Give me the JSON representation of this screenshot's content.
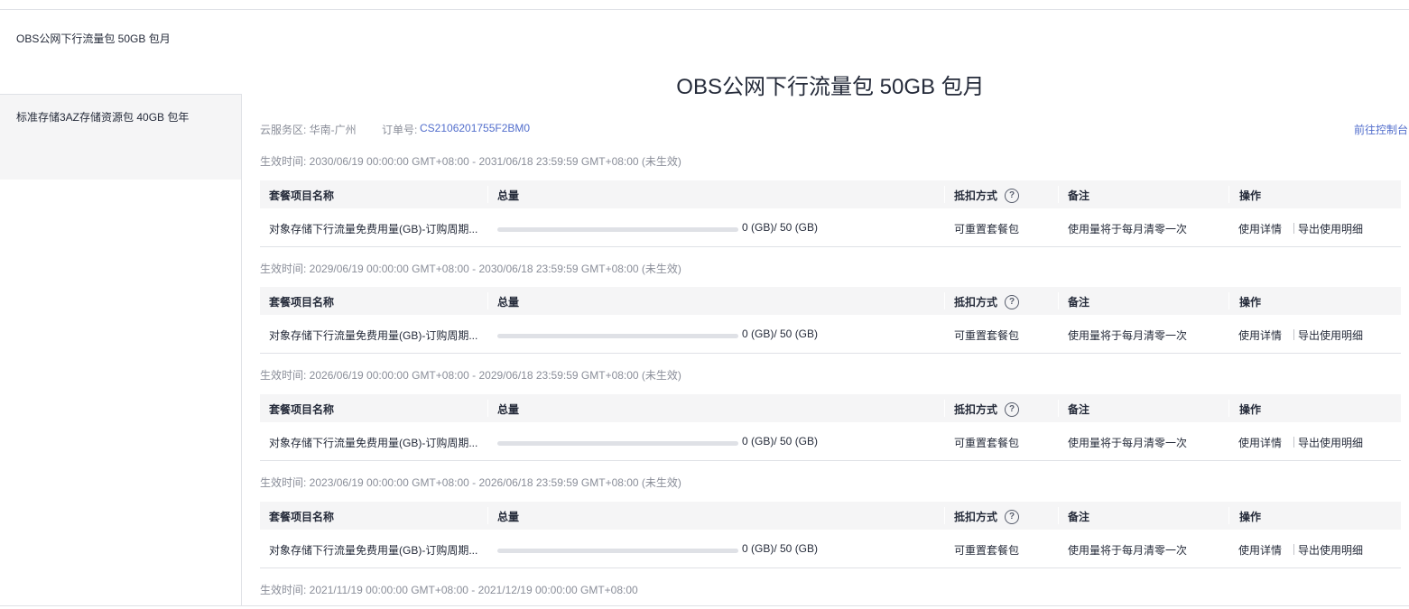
{
  "sidebar": {
    "items": [
      {
        "label": "OBS公网下行流量包 50GB 包月"
      },
      {
        "label": "标准存储3AZ存储资源包 40GB 包年"
      }
    ]
  },
  "main": {
    "title": "OBS公网下行流量包 50GB 包月",
    "service_region": "云服务区: 华南-广州",
    "order_label": "订单号:",
    "order_no": "CS2106201755F2BM0",
    "console_link": "前往控制台"
  },
  "table_headers": {
    "name": "套餐项目名称",
    "total": "总量",
    "deduct": "抵扣方式",
    "remark": "备注",
    "action": "操作"
  },
  "periods": [
    {
      "label": "生效时间: 2030/06/19 00:00:00 GMT+08:00 - 2031/06/18 23:59:59 GMT+08:00 (未生效)",
      "row": {
        "name": "对象存储下行流量免费用量(GB)-订购周期...",
        "usage_text": "0 (GB)/ 50 (GB)",
        "usage_fraction": 0,
        "deduct": "可重置套餐包",
        "remark": "使用量将于每月清零一次",
        "detail_link": "使用详情",
        "export_link": "导出使用明细"
      }
    },
    {
      "label": "生效时间: 2029/06/19 00:00:00 GMT+08:00 - 2030/06/18 23:59:59 GMT+08:00 (未生效)",
      "row": {
        "name": "对象存储下行流量免费用量(GB)-订购周期...",
        "usage_text": "0 (GB)/ 50 (GB)",
        "usage_fraction": 0,
        "deduct": "可重置套餐包",
        "remark": "使用量将于每月清零一次",
        "detail_link": "使用详情",
        "export_link": "导出使用明细"
      }
    },
    {
      "label": "生效时间: 2026/06/19 00:00:00 GMT+08:00 - 2029/06/18 23:59:59 GMT+08:00 (未生效)",
      "row": {
        "name": "对象存储下行流量免费用量(GB)-订购周期...",
        "usage_text": "0 (GB)/ 50 (GB)",
        "usage_fraction": 0,
        "deduct": "可重置套餐包",
        "remark": "使用量将于每月清零一次",
        "detail_link": "使用详情",
        "export_link": "导出使用明细"
      }
    },
    {
      "label": "生效时间: 2023/06/19 00:00:00 GMT+08:00 - 2026/06/18 23:59:59 GMT+08:00 (未生效)",
      "row": {
        "name": "对象存储下行流量免费用量(GB)-订购周期...",
        "usage_text": "0 (GB)/ 50 (GB)",
        "usage_fraction": 0,
        "deduct": "可重置套餐包",
        "remark": "使用量将于每月清零一次",
        "detail_link": "使用详情",
        "export_link": "导出使用明细"
      }
    },
    {
      "label": "生效时间: 2021/11/19 00:00:00 GMT+08:00 - 2021/12/19 00:00:00 GMT+08:00"
    }
  ]
}
